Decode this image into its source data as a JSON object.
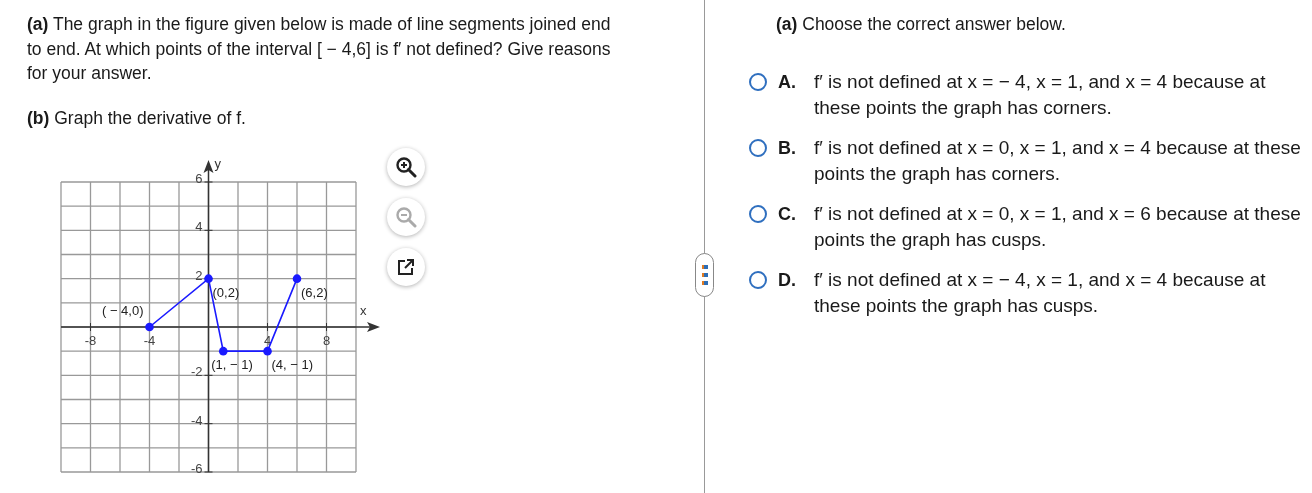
{
  "question": {
    "parts": [
      "**(a)** The graph in the figure given below is made of line segments joined end to end. At which points of the interval [ − 4,6] is f′ not defined? Give reasons for your answer.",
      "**(b)** Graph the derivative of f."
    ],
    "chart_data": {
      "type": "line",
      "xlabel": "x",
      "ylabel": "y",
      "x": [
        -4,
        0,
        1,
        4,
        6
      ],
      "grid": true,
      "series": [
        {
          "color": "#1a1aff",
          "marker": "circle",
          "values": [
            0,
            2,
            -1,
            -1,
            2
          ]
        }
      ],
      "xlim": [
        -10,
        10
      ],
      "ylim": [
        -6,
        6
      ],
      "xticks": [
        -8,
        -4,
        4,
        8
      ],
      "yticks": [
        -6,
        -4,
        -2,
        2,
        4,
        6
      ],
      "annotations": [
        {
          "text": "( − 4,0)",
          "x": -4,
          "y": 0
        },
        {
          "text": "(0,2)",
          "x": 0,
          "y": 2
        },
        {
          "text": "(6,2)",
          "x": 6,
          "y": 2
        },
        {
          "text": "(1, − 1)",
          "x": 1,
          "y": -1
        },
        {
          "text": "(4, − 1)",
          "x": 4,
          "y": -1
        }
      ]
    },
    "tools": [
      {
        "kind": "zoom-in",
        "disabled": false
      },
      {
        "kind": "zoom-out",
        "disabled": true
      },
      {
        "kind": "popout",
        "disabled": false
      }
    ]
  },
  "answer": {
    "heading": "**(a)** Choose the correct answer below.",
    "options": [
      {
        "letter": "A.",
        "text": "f′ is not defined at x =  − 4, x = 1, and x = 4 because at these points the graph has corners.",
        "selected": false
      },
      {
        "letter": "B.",
        "text": "f′ is not defined at x = 0, x = 1, and x = 4 because at these points the graph has corners.",
        "selected": false
      },
      {
        "letter": "C.",
        "text": "f′ is not defined at x = 0, x = 1, and x = 6 because at these points the graph has cusps.",
        "selected": false
      },
      {
        "letter": "D.",
        "text": "f′ is not defined at x =  − 4, x = 1, and x = 4 because at these points the graph has cusps.",
        "selected": false
      }
    ]
  }
}
